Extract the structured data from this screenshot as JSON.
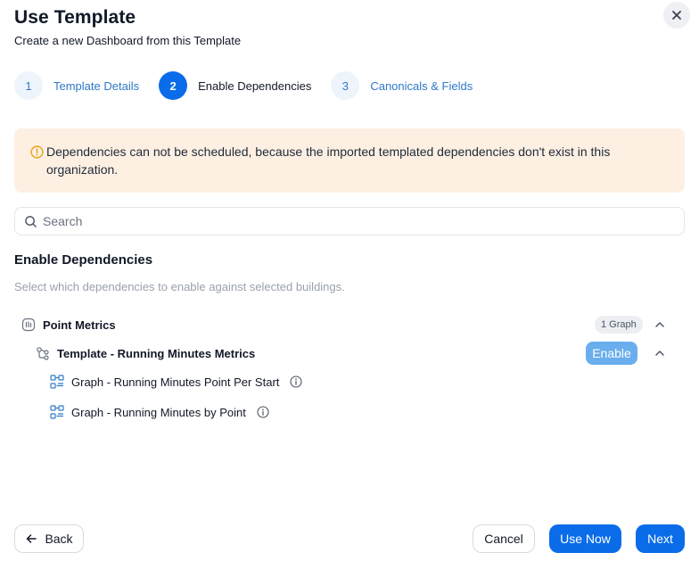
{
  "header": {
    "title": "Use Template",
    "subtitle": "Create a new Dashboard from this Template"
  },
  "stepper": {
    "steps": [
      {
        "number": "1",
        "label": "Template Details"
      },
      {
        "number": "2",
        "label": "Enable Dependencies"
      },
      {
        "number": "3",
        "label": "Canonicals & Fields"
      }
    ],
    "active_step": 2
  },
  "alert": {
    "text": "Dependencies can not be scheduled, because the imported templated dependencies don't exist in this organization."
  },
  "search": {
    "placeholder": "Search"
  },
  "section": {
    "title": "Enable Dependencies",
    "description": "Select which dependencies to enable against selected buildings."
  },
  "dependencies": {
    "group": {
      "label": "Point Metrics",
      "badge": "1 Graph",
      "template": {
        "label": "Template - Running Minutes Metrics",
        "enable_label": "Enable",
        "graphs": [
          {
            "label": "Graph - Running Minutes Point Per Start"
          },
          {
            "label": "Graph - Running Minutes by Point"
          }
        ]
      }
    }
  },
  "footer": {
    "back_label": "Back",
    "cancel_label": "Cancel",
    "use_now_label": "Use Now",
    "next_label": "Next"
  },
  "colors": {
    "primary": "#0a6ce9",
    "link": "#2f79c8",
    "alert_bg": "#fdf0e3",
    "alert_icon": "#e8a317",
    "enable_bg": "#6aaeed"
  },
  "icons": {
    "close": "close-icon",
    "alert": "alert-circle-icon",
    "search": "search-icon",
    "group": "chart-bars-icon",
    "template": "dependency-nodes-icon",
    "graph": "graph-icon",
    "info": "info-icon",
    "chevron": "chevron-up-icon",
    "back": "arrow-left-icon"
  }
}
